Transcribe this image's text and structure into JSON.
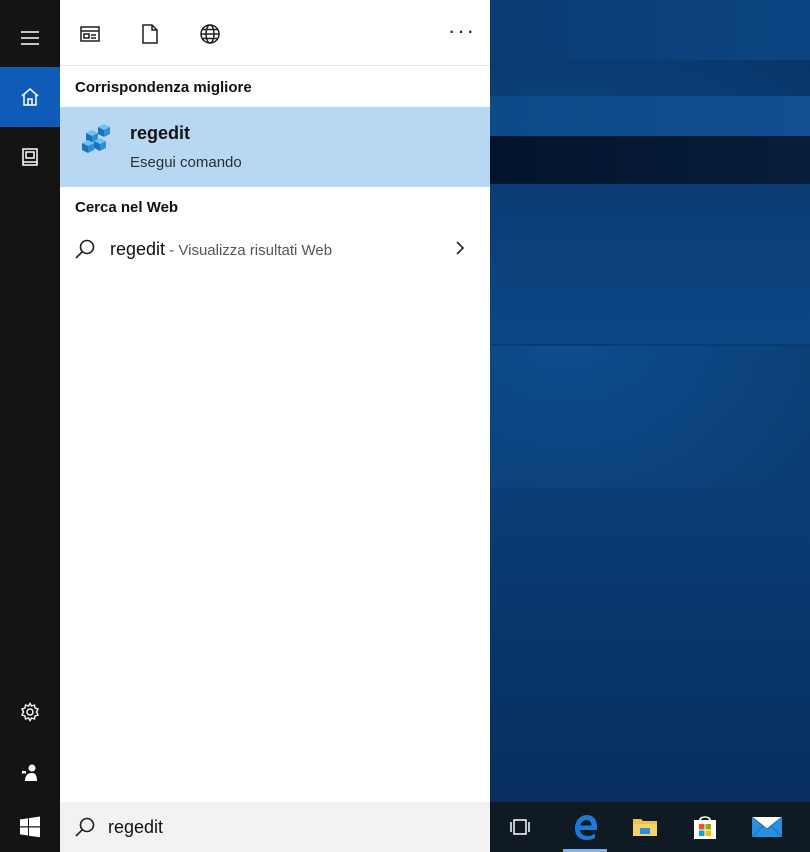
{
  "toolbar": {
    "icons": [
      "apps-filter-icon",
      "documents-filter-icon",
      "web-filter-icon"
    ],
    "more_label": "···"
  },
  "rail": {
    "items": [
      "menu-icon",
      "home-icon",
      "notebook-icon",
      "settings-icon",
      "feedback-icon"
    ]
  },
  "best_match": {
    "header": "Corrispondenza migliore",
    "title": "regedit",
    "subtitle": "Esegui comando"
  },
  "web": {
    "header": "Cerca nel Web",
    "query": "regedit",
    "separator": " - ",
    "description": "Visualizza risultati Web"
  },
  "search": {
    "value": "regedit"
  },
  "colors": {
    "accent": "#0f5bb8",
    "selection": "#b7d7f2",
    "rail_bg": "#141414",
    "panel_bg": "#ffffff"
  },
  "taskbar": {
    "apps": [
      "task-view-icon",
      "edge-icon",
      "file-explorer-icon",
      "store-icon",
      "mail-icon"
    ]
  }
}
